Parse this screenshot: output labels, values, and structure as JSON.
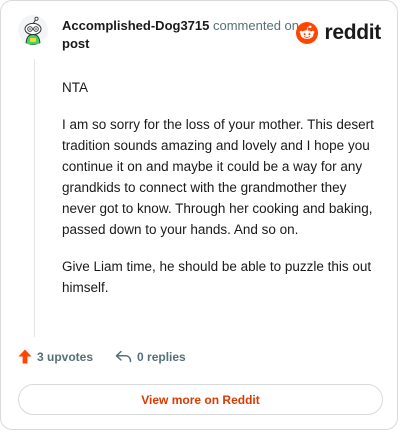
{
  "header": {
    "username": "Accomplished-Dog3715",
    "commented_on": "commented on",
    "post_link": "post"
  },
  "brand": {
    "wordmark": "reddit",
    "color": "#ff4500"
  },
  "comment": {
    "paragraphs": [
      "NTA",
      "I am so sorry for the loss of your mother. This desert tradition sounds amazing and lovely and I hope you continue it on and maybe it could be a way for any grandkids to connect with the grandmother they never got to know. Through her cooking and baking, passed down to your hands. And so on.",
      "Give Liam time, he should be able to puzzle this out himself."
    ]
  },
  "actions": {
    "upvotes": "3 upvotes",
    "replies": "0 replies"
  },
  "view_more": {
    "label": "View more on Reddit"
  },
  "colors": {
    "accent": "#d93a00",
    "upvote": "#ff4500",
    "muted": "#576f76",
    "border": "#d7dadc"
  },
  "icons": {
    "avatar": "snoo-avatar-icon",
    "brand": "reddit-logo-icon",
    "upvote": "upvote-arrow-icon",
    "reply": "reply-arrow-icon"
  }
}
